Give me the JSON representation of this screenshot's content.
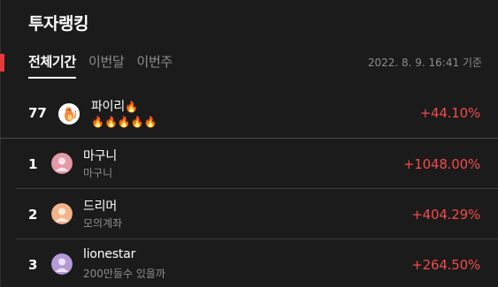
{
  "header": {
    "title": "투자랭킹"
  },
  "tabs": [
    {
      "label": "전체기간",
      "active": true
    },
    {
      "label": "이번달",
      "active": false
    },
    {
      "label": "이번주",
      "active": false
    }
  ],
  "timestamp": "2022. 8. 9. 16:41 기준",
  "my_rank": {
    "rank": "77",
    "name": "파이리",
    "name_badge_icon": "fire-icon",
    "fire_count": 5,
    "rate": "+44.10%",
    "avatar_icon": "charmander-avatar-icon"
  },
  "ranking": [
    {
      "rank": "1",
      "name": "마구니",
      "sub": "마구니",
      "rate": "+1048.00%",
      "avatar_color": "#e39aa6"
    },
    {
      "rank": "2",
      "name": "드리머",
      "sub": "모의계좌",
      "rate": "+404.29%",
      "avatar_color": "#f2b38a"
    },
    {
      "rank": "3",
      "name": "lionestar",
      "sub": "200만들수 있을까",
      "rate": "+264.50%",
      "avatar_color": "#b49ad6"
    }
  ],
  "colors": {
    "background": "#1b1b1b",
    "accent": "#e8383c",
    "positive": "#f04b4b",
    "muted": "#8d8d8d"
  }
}
